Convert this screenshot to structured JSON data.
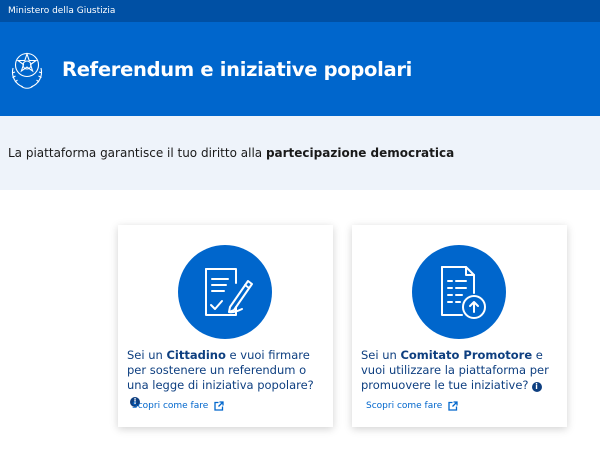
{
  "topbar": {
    "ministry": "Ministero della Giustizia"
  },
  "header": {
    "title": "Referendum e iniziative popolari"
  },
  "intro": {
    "prefix": "La piattaforma garantisce il tuo diritto alla ",
    "bold": "partecipazione democratica"
  },
  "cards": [
    {
      "text_a": "Sei un ",
      "text_bold": "Cittadino",
      "text_b": " e vuoi firmare per sostenere un referendum o una legge di iniziativa popolare?",
      "link": "Scopri come fare",
      "icon": "document-sign-icon"
    },
    {
      "text_a": "Sei un ",
      "text_bold": "Comitato Promotore",
      "text_b": " e vuoi utilizzare la piattaforma per promuovere le tue iniziative?",
      "link": "Scopri come fare",
      "icon": "document-upload-icon"
    }
  ],
  "colors": {
    "brand_blue": "#0066cc",
    "topbar_blue": "#0050a4",
    "text_dark_blue": "#0e3f80",
    "intro_bg": "#eef3fa"
  }
}
